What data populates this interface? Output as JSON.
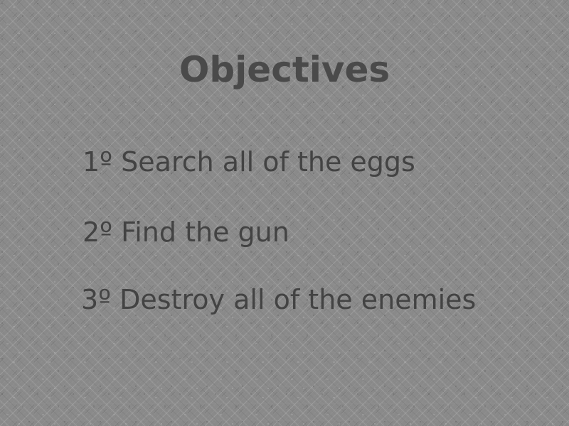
{
  "colors": {
    "background": "#8b8b8b",
    "title_text": "#4a4a4a",
    "objective_text": "#434343"
  },
  "screen": {
    "title": "Objectives",
    "objectives": [
      {
        "label": "1º Search all of the eggs"
      },
      {
        "label": "2º Find the gun"
      },
      {
        "label": "3º Destroy all of the enemies"
      }
    ]
  }
}
